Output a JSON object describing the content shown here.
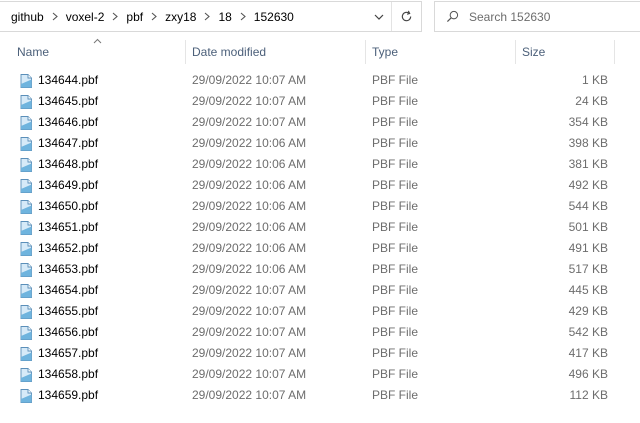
{
  "breadcrumb": {
    "items": [
      "github",
      "voxel-2",
      "pbf",
      "zxy18",
      "18",
      "152630"
    ]
  },
  "search": {
    "placeholder": "Search 152630"
  },
  "columns": {
    "name": "Name",
    "date": "Date modified",
    "type": "Type",
    "size": "Size",
    "sorted_by": "Name"
  },
  "files": [
    {
      "name": "134644.pbf",
      "date": "29/09/2022 10:07 AM",
      "type": "PBF File",
      "size": "1 KB"
    },
    {
      "name": "134645.pbf",
      "date": "29/09/2022 10:07 AM",
      "type": "PBF File",
      "size": "24 KB"
    },
    {
      "name": "134646.pbf",
      "date": "29/09/2022 10:07 AM",
      "type": "PBF File",
      "size": "354 KB"
    },
    {
      "name": "134647.pbf",
      "date": "29/09/2022 10:06 AM",
      "type": "PBF File",
      "size": "398 KB"
    },
    {
      "name": "134648.pbf",
      "date": "29/09/2022 10:06 AM",
      "type": "PBF File",
      "size": "381 KB"
    },
    {
      "name": "134649.pbf",
      "date": "29/09/2022 10:06 AM",
      "type": "PBF File",
      "size": "492 KB"
    },
    {
      "name": "134650.pbf",
      "date": "29/09/2022 10:06 AM",
      "type": "PBF File",
      "size": "544 KB"
    },
    {
      "name": "134651.pbf",
      "date": "29/09/2022 10:06 AM",
      "type": "PBF File",
      "size": "501 KB"
    },
    {
      "name": "134652.pbf",
      "date": "29/09/2022 10:06 AM",
      "type": "PBF File",
      "size": "491 KB"
    },
    {
      "name": "134653.pbf",
      "date": "29/09/2022 10:06 AM",
      "type": "PBF File",
      "size": "517 KB"
    },
    {
      "name": "134654.pbf",
      "date": "29/09/2022 10:07 AM",
      "type": "PBF File",
      "size": "445 KB"
    },
    {
      "name": "134655.pbf",
      "date": "29/09/2022 10:07 AM",
      "type": "PBF File",
      "size": "429 KB"
    },
    {
      "name": "134656.pbf",
      "date": "29/09/2022 10:07 AM",
      "type": "PBF File",
      "size": "542 KB"
    },
    {
      "name": "134657.pbf",
      "date": "29/09/2022 10:07 AM",
      "type": "PBF File",
      "size": "417 KB"
    },
    {
      "name": "134658.pbf",
      "date": "29/09/2022 10:07 AM",
      "type": "PBF File",
      "size": "496 KB"
    },
    {
      "name": "134659.pbf",
      "date": "29/09/2022 10:07 AM",
      "type": "PBF File",
      "size": "112 KB"
    }
  ],
  "icons": {
    "file": "generic-file-icon",
    "dropdown": "chevron-down-icon",
    "refresh": "refresh-icon",
    "search": "search-icon",
    "separator": "chevron-right-icon",
    "sort": "sort-ascending-icon"
  },
  "colors": {
    "header_text": "#4c607a",
    "detail_text": "#6d6d6d",
    "border": "#d9d9d9"
  }
}
